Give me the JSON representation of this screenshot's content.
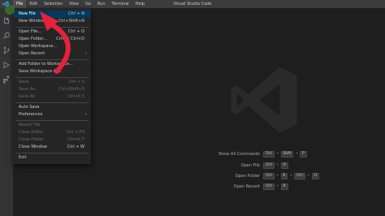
{
  "window_title": "Visual Studio Code",
  "menubar": [
    "File",
    "Edit",
    "Selection",
    "View",
    "Go",
    "Run",
    "Terminal",
    "Help"
  ],
  "file_menu": {
    "items": [
      {
        "label": "New File",
        "accel": "Ctrl + N",
        "highlighted": true
      },
      {
        "label": "New Window",
        "accel": "Ctrl+Shift+N"
      },
      {
        "label": "Open File...",
        "accel": "Ctrl + O"
      },
      {
        "label": "Open Folder...",
        "accel": "Ctrl+K Ctrl+O"
      },
      {
        "label": "Open Workspace...",
        "accel": ""
      },
      {
        "label": "Open Recent",
        "accel": "",
        "submenu": true
      },
      {
        "label": "Add Folder to Workspace...",
        "accel": ""
      },
      {
        "label": "Save Workspace As...",
        "accel": ""
      },
      {
        "label": "Save",
        "accel": "Ctrl + S",
        "disabled": true
      },
      {
        "label": "Save As...",
        "accel": "Ctrl+Shift+S",
        "disabled": true
      },
      {
        "label": "Save All",
        "accel": "Ctrl+K S",
        "disabled": true
      },
      {
        "label": "Auto Save",
        "accel": ""
      },
      {
        "label": "Preferences",
        "accel": "",
        "submenu": true
      },
      {
        "label": "Revert File",
        "accel": "",
        "disabled": true
      },
      {
        "label": "Close Editor",
        "accel": "Ctrl + F4",
        "disabled": true
      },
      {
        "label": "Close Folder",
        "accel": "Ctrl+K F",
        "disabled": true
      },
      {
        "label": "Close Window",
        "accel": "Ctrl + W"
      },
      {
        "label": "Exit",
        "accel": ""
      }
    ]
  },
  "shortcuts": [
    {
      "label": "Show All Commands",
      "keys": [
        "Ctrl",
        "Shift",
        "P"
      ]
    },
    {
      "label": "Open File",
      "keys": [
        "Ctrl",
        "O"
      ]
    },
    {
      "label": "Open Folder",
      "keys": [
        "Ctrl",
        "K",
        "Ctrl",
        "O"
      ]
    },
    {
      "label": "Open Recent",
      "keys": [
        "Ctrl",
        "R"
      ]
    }
  ],
  "activity_icons": [
    "explorer-icon",
    "search-icon",
    "source-control-icon",
    "run-debug-icon",
    "extensions-icon"
  ],
  "colors": {
    "accent": "#007acc",
    "annotation": "#e8213b",
    "highlight": "#04395e"
  }
}
